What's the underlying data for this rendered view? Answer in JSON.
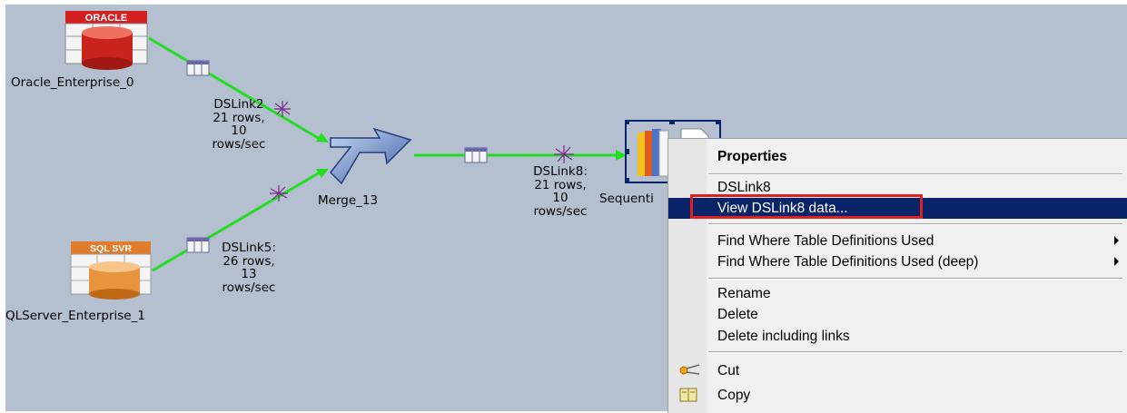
{
  "canvas": {
    "stages": {
      "oracle": {
        "name": "Oracle_Enterprise_0",
        "badge": "ORACLE"
      },
      "sqlserver": {
        "name": "QLServer_Enterprise_1",
        "badge": "SQL SVR"
      },
      "merge": {
        "name": "Merge_13"
      },
      "sequential": {
        "name": "Sequenti"
      }
    },
    "links": {
      "dslink2": {
        "name": "DSLink2",
        "rows": "21 rows,",
        "rate_value": "10",
        "rate_unit": "rows/sec"
      },
      "dslink5": {
        "name": "DSLink5:",
        "rows": "26 rows,",
        "rate_value": "13",
        "rate_unit": "rows/sec"
      },
      "dslink8": {
        "name": "DSLink8:",
        "rows": "21 rows,",
        "rate_value": "10",
        "rate_unit": "rows/sec"
      }
    },
    "colors": {
      "background": "#b4bfcf",
      "link_line": "#22dd22",
      "selection": "#0a246a",
      "highlight_box": "#e0201e"
    }
  },
  "context_menu": {
    "properties": "Properties",
    "link_name": "DSLink8",
    "view_data": "View DSLink8 data...",
    "find_where": "Find Where Table Definitions Used",
    "find_where_deep": "Find Where Table Definitions Used (deep)",
    "rename": "Rename",
    "delete": "Delete",
    "delete_links": "Delete including links",
    "cut": "Cut",
    "copy": "Copy",
    "icons": {
      "cut": "scissors-icon",
      "copy": "copy-icon",
      "submenu": "submenu-arrow-icon"
    }
  }
}
